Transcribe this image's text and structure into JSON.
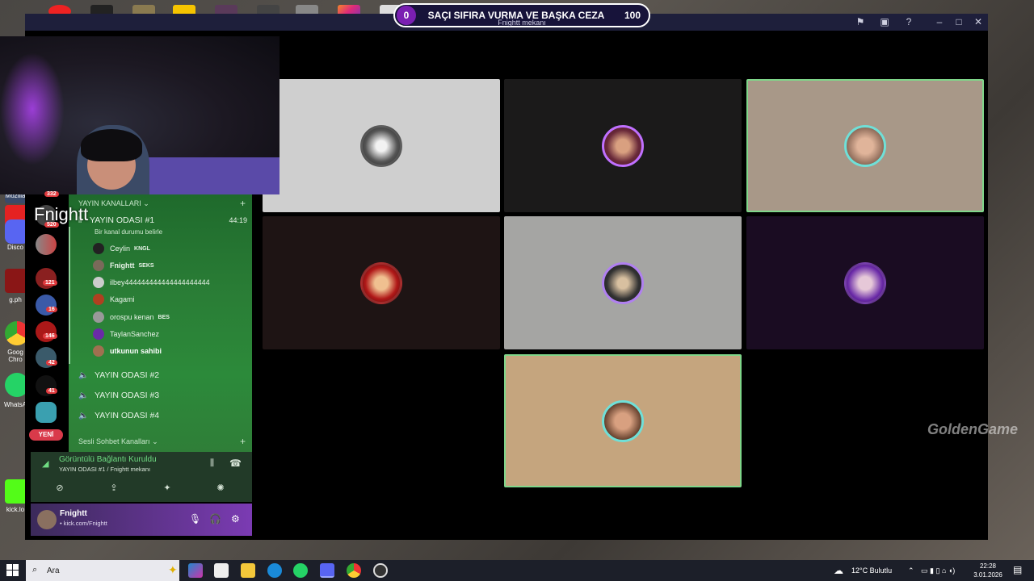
{
  "banner": {
    "left_value": "0",
    "title": "SAÇI SIFIRA VURMA VE BAŞKA CEZA",
    "right_value": "100",
    "subtitle": "Fnightt mekanı"
  },
  "webcam_name": "Fnightt",
  "desktop_labels": [
    "Mozilla",
    "Disco",
    "g.ph",
    "Goog Chro",
    "WhatsA",
    "kick.lo"
  ],
  "rail": {
    "badges": [
      "332",
      "520",
      "121",
      "16",
      "146",
      "42",
      "41"
    ],
    "new_label": "YENİ"
  },
  "channels": {
    "category1": "YAYIN KANALLARI",
    "active_channel": {
      "name": "YAYIN ODASI #1",
      "time": "44:19",
      "status": "Bir kanal durumu belirle"
    },
    "members": [
      {
        "name": "Ceylin",
        "tag": "KNGL"
      },
      {
        "name": "Fnightt",
        "tag": "SEKS"
      },
      {
        "name": "ilbey444444444444444444444",
        "tag": ""
      },
      {
        "name": "Kagami",
        "tag": ""
      },
      {
        "name": "orospu kenan",
        "tag": "BES"
      },
      {
        "name": "TaylanSanchez",
        "tag": ""
      },
      {
        "name": "utkunun sahibi",
        "tag": ""
      }
    ],
    "other_channels": [
      "YAYIN ODASI #2",
      "YAYIN ODASI #3",
      "YAYIN ODASI #4"
    ],
    "category2": "Sesli Sohbet Kanalları"
  },
  "voice_panel": {
    "title": "Görüntülü Bağlantı Kuruldu",
    "subtitle": "YAYIN ODASI #1 / Fnightt mekanı"
  },
  "user_panel": {
    "name": "Fnightt",
    "status": "• kick.com/Fnightt"
  },
  "watermark": "GoldenGame",
  "taskbar": {
    "search_placeholder": "Ara",
    "weather": "12°C Bulutlu",
    "time": "22:28",
    "date": "3.01.2026"
  },
  "colors": {
    "accent_green": "#2c8a3a",
    "active_border": "#7fd68a",
    "banner_purple": "#7a1fb2"
  }
}
